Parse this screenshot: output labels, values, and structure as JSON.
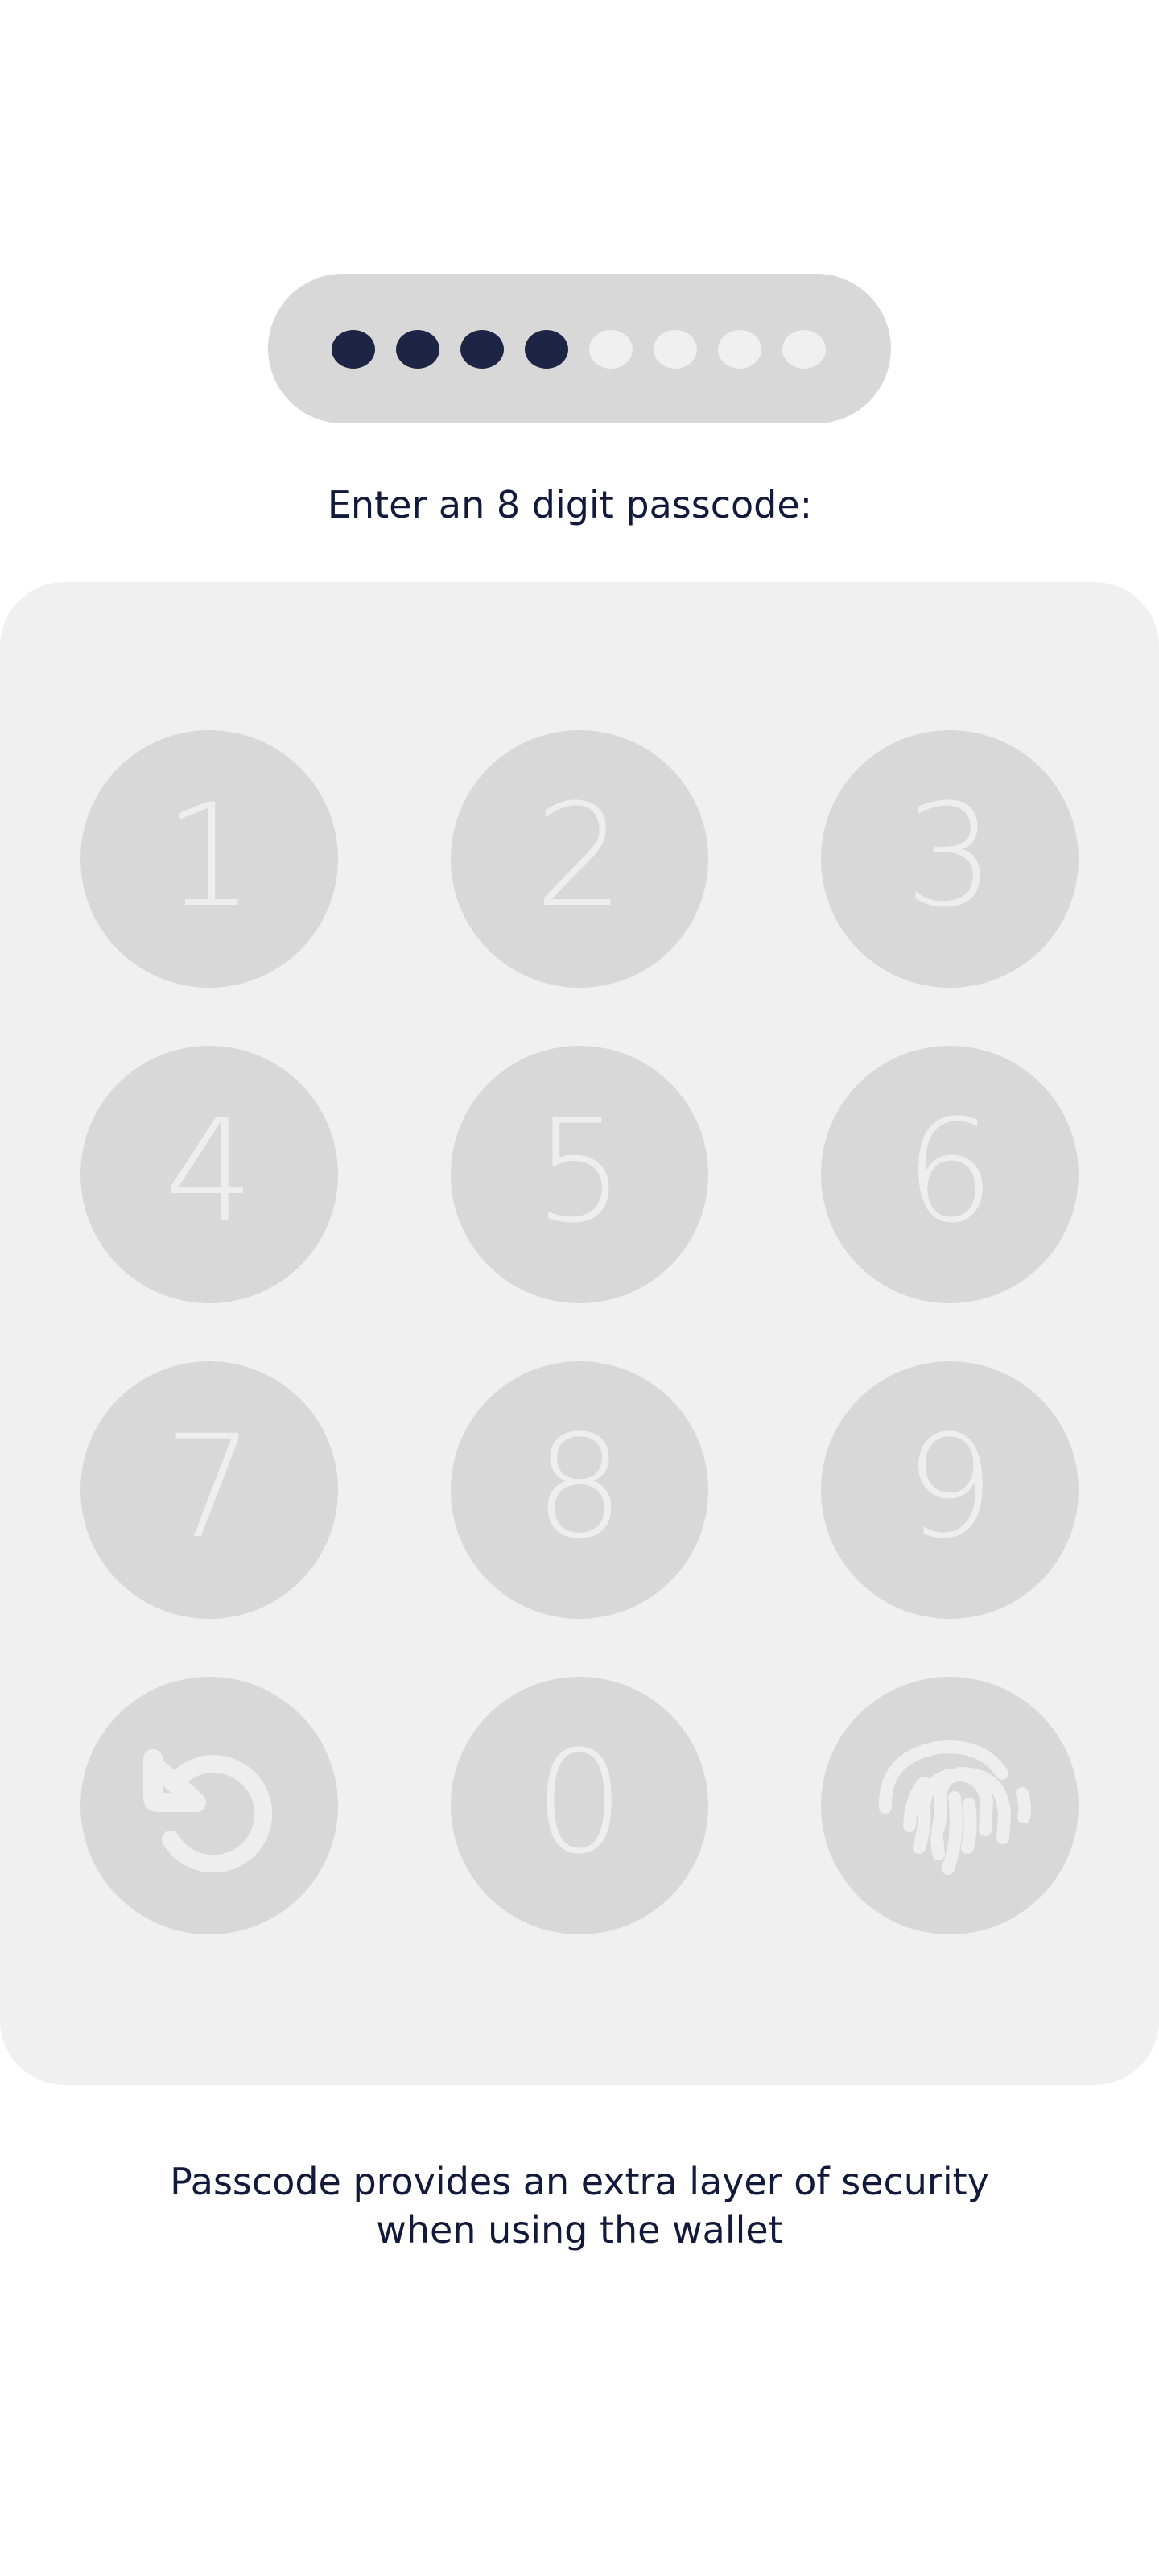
{
  "passcode": {
    "length": 8,
    "entered": 4,
    "colors": {
      "filled": "#1e2544",
      "empty": "#f0f0f0"
    }
  },
  "prompt": "Enter an 8 digit passcode:",
  "keypad": {
    "keys": [
      "1",
      "2",
      "3",
      "4",
      "5",
      "6",
      "7",
      "8",
      "9"
    ],
    "zero": "0",
    "reset_icon": "reset-icon",
    "fingerprint_icon": "fingerprint-icon"
  },
  "footer": {
    "line1": "Passcode provides an extra layer of security",
    "line2": "when using the wallet"
  },
  "colors": {
    "text": "#111a3a",
    "key_bg": "#d8d8d8",
    "panel_bg": "#f0f0f0"
  }
}
